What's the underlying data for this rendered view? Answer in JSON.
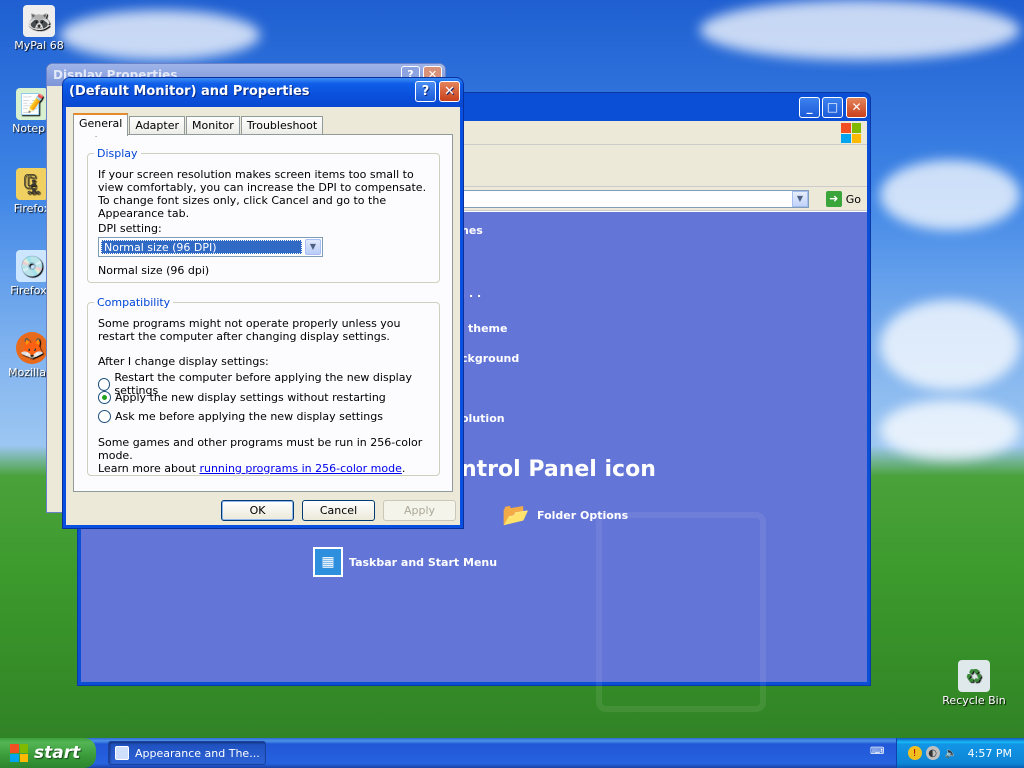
{
  "desktop": {
    "icons": [
      {
        "label": "MyPal 68",
        "icon": "raccoon-icon"
      },
      {
        "label": "Notepa",
        "icon": "notepad-icon"
      },
      {
        "label": "Firefox",
        "icon": "zip-icon"
      },
      {
        "label": "FirefoxS",
        "icon": "firefox-setup-icon"
      },
      {
        "label": "Mozilla F",
        "icon": "firefox-icon"
      },
      {
        "label": "Recycle Bin",
        "icon": "recycle-bin-icon"
      }
    ]
  },
  "control_panel": {
    "go_label": "Go",
    "links": [
      "nes",
      ". . .",
      "theme",
      "ckground",
      "olution"
    ],
    "heading": "ntrol Panel icon",
    "items": [
      {
        "label": "Folder Options",
        "icon": "folder-options-icon"
      },
      {
        "label": "Taskbar and Start Menu",
        "icon": "taskbar-icon"
      }
    ]
  },
  "display_properties": {
    "title": "Display Properties"
  },
  "dialog": {
    "title": "(Default Monitor) and  Properties",
    "tabs": [
      "General",
      "Adapter",
      "Monitor",
      "Troubleshoot"
    ],
    "active_tab": "General",
    "display_group": {
      "legend": "Display",
      "description": "If your screen resolution makes screen items too small to view comfortably, you can increase the DPI to compensate.  To change font sizes only, click Cancel and go to the Appearance tab.",
      "dpi_label": "DPI setting:",
      "dpi_value": "Normal size (96 DPI)",
      "dpi_caption": "Normal size (96 dpi)"
    },
    "compat_group": {
      "legend": "Compatibility",
      "description": "Some programs might not operate properly unless you restart the computer after changing display settings.",
      "after_label": "After I change display settings:",
      "options": [
        {
          "label": "Restart the computer before applying the new display settings",
          "checked": false
        },
        {
          "label": "Apply the new display settings without restarting",
          "checked": true
        },
        {
          "label": "Ask me before applying the new display settings",
          "checked": false
        }
      ],
      "note_line1": "Some games and other programs must be run in 256-color mode.",
      "note_prefix": "Learn more about ",
      "note_link": "running programs in 256-color mode",
      "note_suffix": "."
    },
    "buttons": {
      "ok": "OK",
      "cancel": "Cancel",
      "apply": "Apply"
    }
  },
  "taskbar": {
    "start_label": "start",
    "task_label": "Appearance and The...",
    "clock": "4:57 PM"
  }
}
